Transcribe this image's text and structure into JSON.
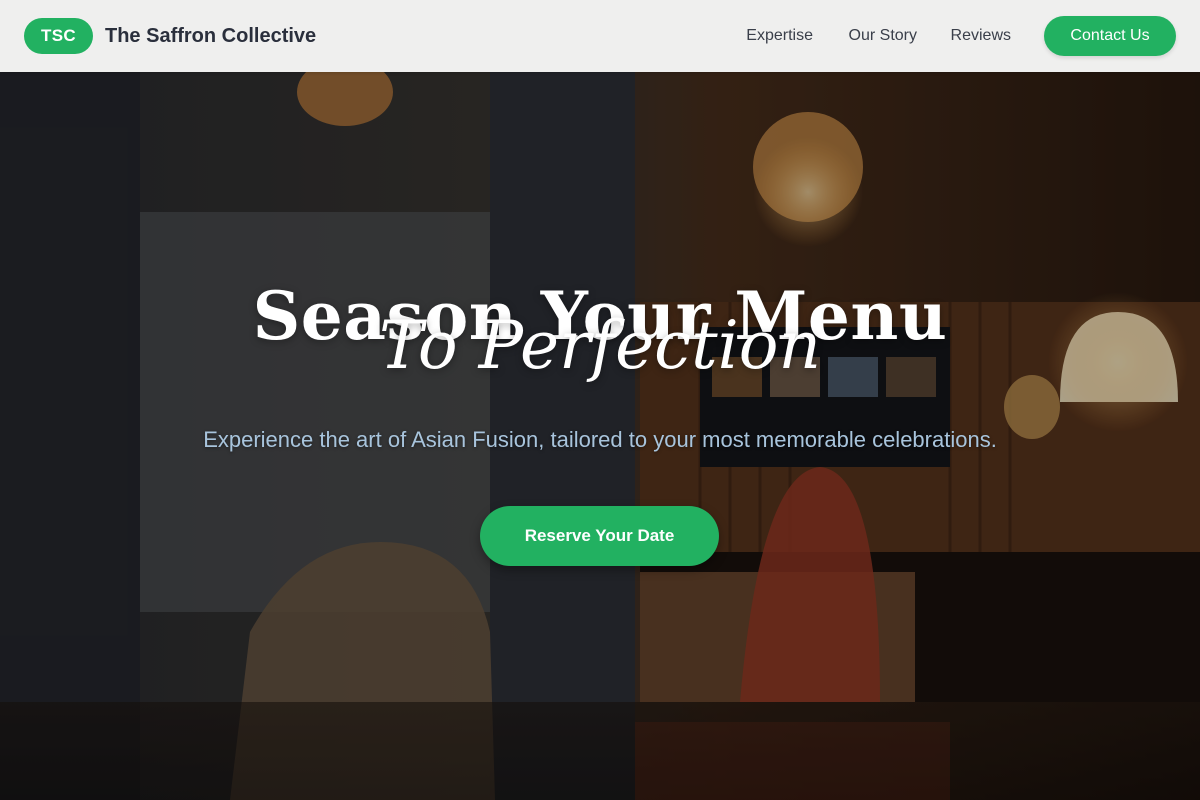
{
  "header": {
    "logo_badge": "TSC",
    "brand_name": "The Saffron Collective",
    "nav": {
      "expertise": "Expertise",
      "our_story": "Our Story",
      "reviews": "Reviews"
    },
    "contact_button": "Contact Us"
  },
  "hero": {
    "title_line1": "Season Your Menu",
    "title_line2": "To Perfection",
    "subtitle": "Experience the art of Asian Fusion, tailored to your most memorable celebrations.",
    "cta_button": "Reserve Your Date",
    "background_image": "restaurant-interior-photo"
  },
  "colors": {
    "accent_green": "#22b161",
    "header_bg": "#efefee",
    "brand_text": "#2a2f3c",
    "subtitle_text": "#a8c4dc"
  }
}
